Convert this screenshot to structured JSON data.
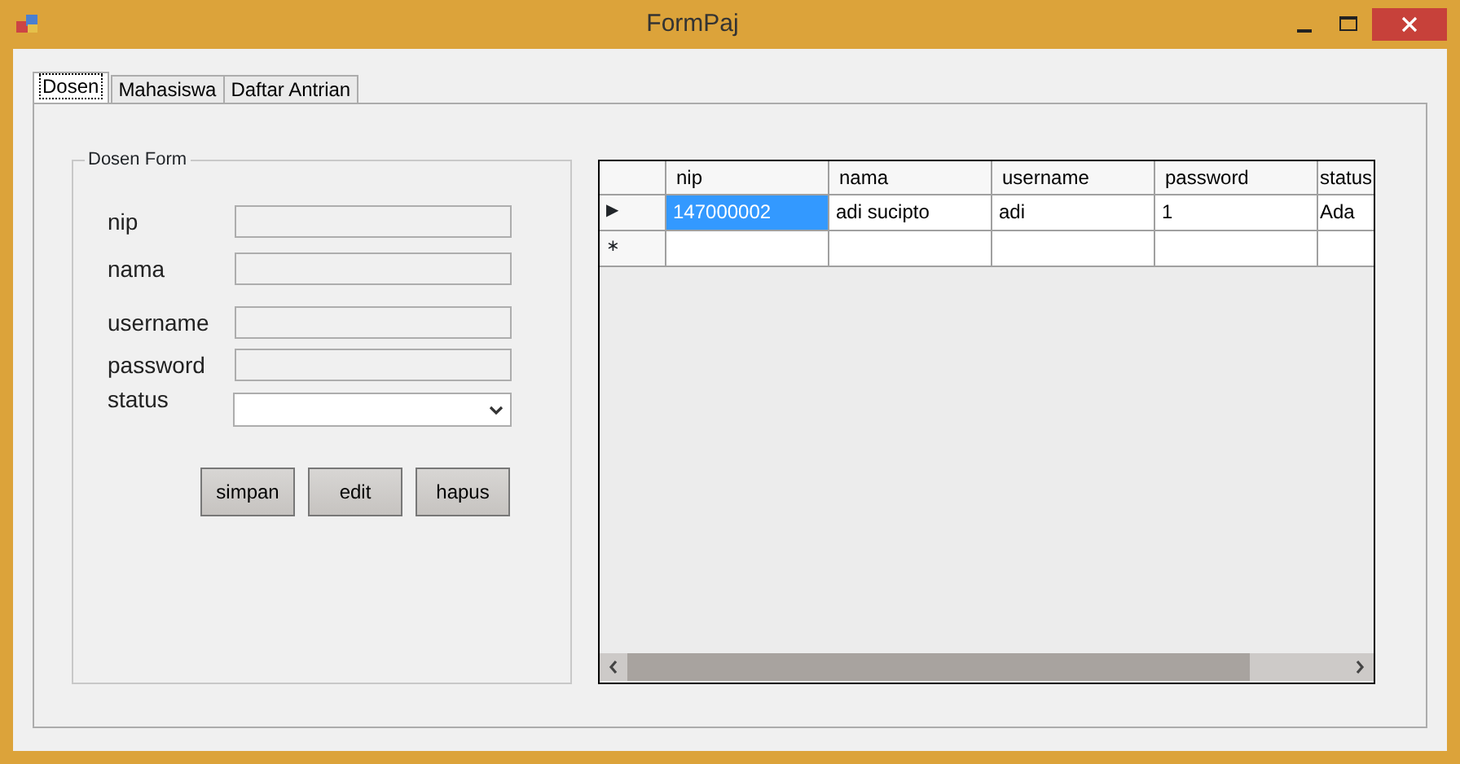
{
  "window": {
    "title": "FormPaj"
  },
  "tabs": [
    {
      "label": "Dosen",
      "selected": true
    },
    {
      "label": "Mahasiswa",
      "selected": false
    },
    {
      "label": "Daftar Antrian",
      "selected": false
    }
  ],
  "form": {
    "title": "Dosen Form",
    "fields": [
      {
        "kind": "text",
        "label": "nip"
      },
      {
        "kind": "text",
        "label": "nama"
      },
      {
        "kind": "text",
        "label": "username"
      },
      {
        "kind": "text",
        "label": "password"
      },
      {
        "kind": "select",
        "label": "status"
      }
    ],
    "buttons": [
      "simpan",
      "edit",
      "hapus"
    ]
  },
  "grid": {
    "columns": [
      "nip",
      "nama",
      "username",
      "password",
      "status"
    ],
    "rows": [
      {
        "indicator": "▶",
        "cells": [
          {
            "text": "147000002",
            "selected": true
          },
          {
            "text": "adi sucipto",
            "selected": false
          },
          {
            "text": "adi",
            "selected": false
          },
          {
            "text": "1",
            "selected": false
          },
          {
            "text": "Ada",
            "selected": false
          }
        ]
      },
      {
        "indicator": "∗",
        "cells": [
          {
            "text": "",
            "selected": false
          },
          {
            "text": "",
            "selected": false
          },
          {
            "text": "",
            "selected": false
          },
          {
            "text": "",
            "selected": false
          },
          {
            "text": "",
            "selected": false
          }
        ]
      }
    ]
  }
}
